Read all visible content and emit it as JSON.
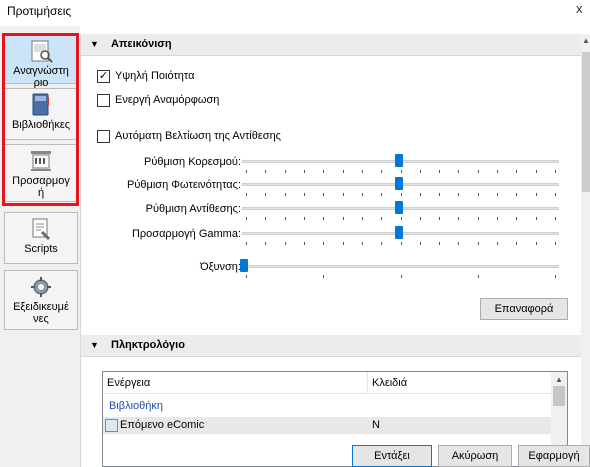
{
  "window": {
    "title": "Προτιμήσεις",
    "close_glyph": "x"
  },
  "sidebar": {
    "items": [
      {
        "label": "Αναγνώστη\nριο",
        "icon": "reader-icon",
        "selected": true
      },
      {
        "label": "Βιβλιοθήκες",
        "icon": "library-book-icon",
        "selected": false
      },
      {
        "label": "Προσαρμογ\nή",
        "icon": "customize-icon",
        "selected": false
      },
      {
        "label": "Scripts",
        "icon": "scripts-icon",
        "selected": false
      },
      {
        "label": "Εξειδικευμέ\nνες",
        "icon": "advanced-gear-icon",
        "selected": false
      }
    ]
  },
  "display": {
    "header": "Απεικόνιση",
    "high_quality": {
      "label": "Υψηλή Ποιότητα",
      "checked": true
    },
    "active_resize": {
      "label": "Ενεργή Αναμόρφωση",
      "checked": false
    },
    "auto_contrast": {
      "label": "Αυτόματη Βελτίωση της Αντίθεσης",
      "checked": false
    },
    "sliders": [
      {
        "label": "Ρύθμιση Κορεσμού:",
        "value": 0.5
      },
      {
        "label": "Ρύθμιση Φωτεινότητας:",
        "value": 0.5
      },
      {
        "label": "Ρύθμιση Αντίθεσης:",
        "value": 0.5
      },
      {
        "label": "Προσαρμογή Gamma:",
        "value": 0.5
      },
      {
        "label": "Όξυνση:",
        "value": 0.0
      }
    ],
    "reset_button": "Επαναφορά"
  },
  "keyboard": {
    "header": "Πληκτρολόγιο",
    "columns": [
      "Ενέργεια",
      "Κλειδιά"
    ],
    "group": "Βιβλιοθήκη",
    "rows": [
      {
        "action": "Επόμενο eComic",
        "keys": "N"
      }
    ]
  },
  "footer": {
    "ok": "Εντάξει",
    "cancel": "Ακύρωση",
    "apply": "Εφαρμογή"
  },
  "colors": {
    "accent": "#0078d7",
    "highlight": "#e8141c",
    "group_link": "#1e4ea6"
  }
}
